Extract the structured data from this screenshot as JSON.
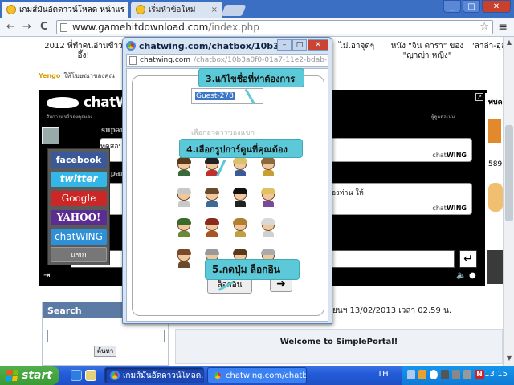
{
  "browser": {
    "tabs": [
      {
        "label": "เกมส์มันอัดดาวน์โหลด หน้าแร"
      },
      {
        "label": "เริ่มหัวข้อใหม่"
      }
    ],
    "close_glyph": "×",
    "url_domain": "www.gamehitdownload.com",
    "url_path": "/index.php",
    "nav": {
      "back": "←",
      "forward": "→",
      "reload": "C"
    },
    "star": "☆",
    "menu": "≡",
    "window_buttons": {
      "minimize": "_",
      "maximize": "□",
      "close": "✕"
    }
  },
  "page": {
    "news": [
      "2012 ที่ทำคนอ่านข้าว\nอึ้ง!",
      "ไม่เอาจุดๆ",
      "หนัง \"จิน ดารา\" ของ\n\"ญาญ่า หญิง\"",
      "'ลาล่า-อุลู"
    ],
    "yengo_brand": "Yengo",
    "yengo_text": "ให้โฆษณาของคุณ",
    "chatwing": {
      "logo": "chatWI",
      "subtitle": "รับการแชร์ของคุณเอง",
      "top_right": "ผู้ดูแลระบบ",
      "corner": "↗",
      "right_label": "พบค",
      "messages": [
        {
          "name": "suparak201",
          "text": "ทดสอบการแม",
          "sig_plain": "chat",
          "sig_bold": "WING"
        },
        {
          "name": "suparak201",
          "text": "งานจะไปขันฮันการสมัครสมาชิกของท่าน ให้",
          "sig_plain": "chat",
          "sig_bold": "WING"
        }
      ],
      "ad_number": "589",
      "input_placeholder": "ข้อความแจ",
      "send": "↵"
    },
    "social_buttons": [
      "facebook",
      "twitter",
      "Google",
      "YAHOO!",
      "chatWING",
      "แขก"
    ],
    "search": {
      "title": "Search",
      "button": "ค้นหา"
    },
    "portal": {
      "date": "ยนฯ 13/02/2013  เวลา 02.59 น.",
      "welcome": "Welcome to SimplePortal!"
    }
  },
  "popup": {
    "title": "chatwing.com/chatbox/10b3a...",
    "url_main": "chatwing.com",
    "url_rest": "/chatbox/10b3a0f0-01a7-11e2-bdab-75f5b0bc",
    "guest_name": "Guest-278",
    "choose_label": "เลือกอวตารของแขก",
    "login_button": "ล็อกอิน",
    "go_button": "➜",
    "callouts": {
      "step3": "3.แก้ไขชื่อที่ท่าต้องการ",
      "step4": "4.เลือกรูปการ์ตูนที่คุณต้อง",
      "step5": "5.กดปุ่ม ล็อกอิน"
    },
    "buttons": {
      "minimize": "–",
      "maximize": "□",
      "close": "✕"
    }
  },
  "taskbar": {
    "start": "start",
    "tasks": [
      "เกมส์มันอัดดาวน์โหลด...",
      "chatwing.com/chatbo..."
    ],
    "language": "TH",
    "time": "13:15"
  }
}
